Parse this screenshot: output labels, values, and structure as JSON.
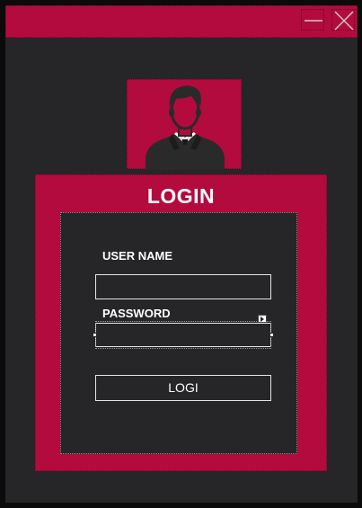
{
  "window": {
    "accent_color": "#b30b3e",
    "background_color": "#262527",
    "controls": {
      "minimize_icon": "minimize-icon",
      "close_icon": "close-icon"
    }
  },
  "avatar": {
    "icon": "user-avatar-icon"
  },
  "login": {
    "title": "LOGIN",
    "username_label": "USER NAME",
    "username_value": "",
    "password_label": "PASSWORD",
    "password_value": "",
    "button_label": "LOGI"
  }
}
